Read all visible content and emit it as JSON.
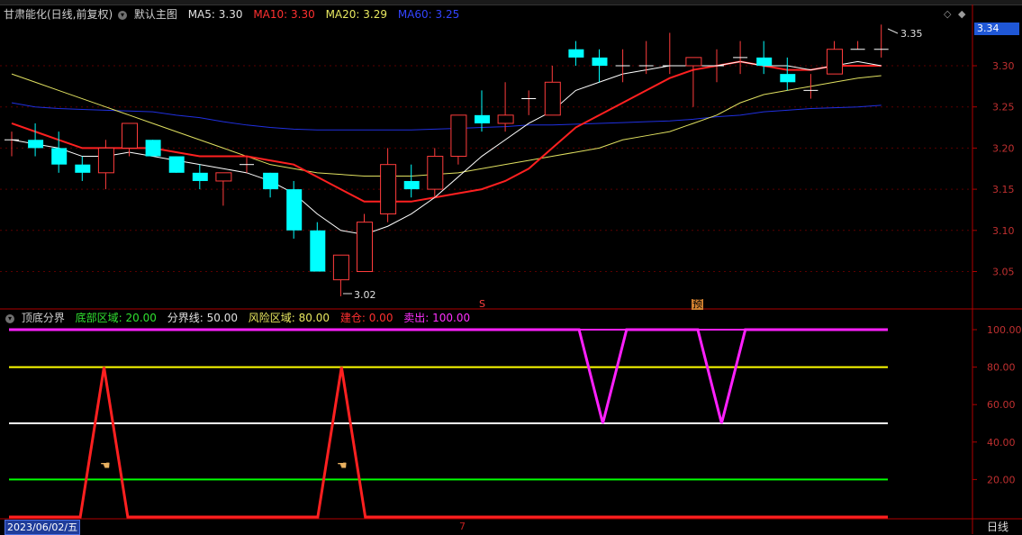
{
  "header": {
    "title": "甘肃能化(日线,前复权)",
    "main_indicator": "默认主图",
    "ma5_label": "MA5:",
    "ma5_value": "3.30",
    "ma10_label": "MA10:",
    "ma10_value": "3.30",
    "ma20_label": "MA20:",
    "ma20_value": "3.29",
    "ma60_label": "MA60:",
    "ma60_value": "3.25"
  },
  "indicator_header": {
    "name": "顶底分界",
    "bottom_label": "底部区域:",
    "bottom_value": "20.00",
    "divide_label": "分界线:",
    "divide_value": "50.00",
    "risk_label": "风险区域:",
    "risk_value": "80.00",
    "build_label": "建仓:",
    "build_value": "0.00",
    "sell_label": "卖出:",
    "sell_value": "100.00"
  },
  "price_tag": "3.34",
  "max_label": "3.35",
  "min_label": "3.02",
  "date_cursor": "2023/06/02/五",
  "period": "日线",
  "month_marker": "7",
  "marker_s": "S",
  "marker_yu": "预",
  "colors": {
    "up": "#ff3c3c",
    "down": "#00ffff",
    "ma5": "#ffffff",
    "ma10": "#ff2020",
    "ma20": "#e0e060",
    "ma60": "#2030e0",
    "axis": "#b00000",
    "indicator": "#ff2020",
    "sell": "#ff20ff",
    "bottom": "#00ff00",
    "divide": "#ffffff",
    "risk": "#ffff00"
  },
  "chart_data": [
    {
      "type": "candlestick",
      "title": "甘肃能化(日线,前复权)",
      "y_ticks": [
        "3.30",
        "3.25",
        "3.20",
        "3.15",
        "3.10",
        "3.05"
      ],
      "ylim": [
        3.02,
        3.38
      ],
      "candles": [
        {
          "o": 3.21,
          "h": 3.22,
          "l": 3.19,
          "c": 3.21
        },
        {
          "o": 3.21,
          "h": 3.23,
          "l": 3.19,
          "c": 3.2
        },
        {
          "o": 3.2,
          "h": 3.22,
          "l": 3.17,
          "c": 3.18
        },
        {
          "o": 3.18,
          "h": 3.19,
          "l": 3.16,
          "c": 3.17
        },
        {
          "o": 3.17,
          "h": 3.21,
          "l": 3.15,
          "c": 3.2
        },
        {
          "o": 3.2,
          "h": 3.23,
          "l": 3.19,
          "c": 3.23
        },
        {
          "o": 3.21,
          "h": 3.21,
          "l": 3.19,
          "c": 3.19
        },
        {
          "o": 3.19,
          "h": 3.19,
          "l": 3.17,
          "c": 3.17
        },
        {
          "o": 3.17,
          "h": 3.18,
          "l": 3.15,
          "c": 3.16
        },
        {
          "o": 3.16,
          "h": 3.17,
          "l": 3.13,
          "c": 3.17
        },
        {
          "o": 3.18,
          "h": 3.19,
          "l": 3.17,
          "c": 3.18
        },
        {
          "o": 3.17,
          "h": 3.17,
          "l": 3.14,
          "c": 3.15
        },
        {
          "o": 3.15,
          "h": 3.16,
          "l": 3.09,
          "c": 3.1
        },
        {
          "o": 3.1,
          "h": 3.11,
          "l": 3.05,
          "c": 3.05
        },
        {
          "o": 3.04,
          "h": 3.07,
          "l": 3.02,
          "c": 3.07
        },
        {
          "o": 3.05,
          "h": 3.12,
          "l": 3.05,
          "c": 3.11
        },
        {
          "o": 3.12,
          "h": 3.2,
          "l": 3.11,
          "c": 3.18
        },
        {
          "o": 3.16,
          "h": 3.18,
          "l": 3.14,
          "c": 3.15
        },
        {
          "o": 3.15,
          "h": 3.2,
          "l": 3.14,
          "c": 3.19
        },
        {
          "o": 3.19,
          "h": 3.24,
          "l": 3.18,
          "c": 3.24
        },
        {
          "o": 3.24,
          "h": 3.27,
          "l": 3.22,
          "c": 3.23
        },
        {
          "o": 3.23,
          "h": 3.28,
          "l": 3.22,
          "c": 3.24
        },
        {
          "o": 3.26,
          "h": 3.27,
          "l": 3.24,
          "c": 3.26
        },
        {
          "o": 3.24,
          "h": 3.3,
          "l": 3.24,
          "c": 3.28
        },
        {
          "o": 3.32,
          "h": 3.33,
          "l": 3.3,
          "c": 3.31
        },
        {
          "o": 3.31,
          "h": 3.32,
          "l": 3.28,
          "c": 3.3
        },
        {
          "o": 3.3,
          "h": 3.32,
          "l": 3.28,
          "c": 3.3
        },
        {
          "o": 3.3,
          "h": 3.33,
          "l": 3.29,
          "c": 3.3
        },
        {
          "o": 3.3,
          "h": 3.34,
          "l": 3.29,
          "c": 3.3
        },
        {
          "o": 3.3,
          "h": 3.31,
          "l": 3.25,
          "c": 3.31
        },
        {
          "o": 3.3,
          "h": 3.32,
          "l": 3.28,
          "c": 3.3
        },
        {
          "o": 3.31,
          "h": 3.33,
          "l": 3.29,
          "c": 3.31
        },
        {
          "o": 3.31,
          "h": 3.33,
          "l": 3.29,
          "c": 3.3
        },
        {
          "o": 3.29,
          "h": 3.31,
          "l": 3.27,
          "c": 3.28
        },
        {
          "o": 3.27,
          "h": 3.29,
          "l": 3.26,
          "c": 3.27
        },
        {
          "o": 3.29,
          "h": 3.33,
          "l": 3.29,
          "c": 3.32
        },
        {
          "o": 3.32,
          "h": 3.33,
          "l": 3.32,
          "c": 3.32
        },
        {
          "o": 3.32,
          "h": 3.35,
          "l": 3.31,
          "c": 3.32
        }
      ],
      "ma5": [
        3.21,
        3.205,
        3.2,
        3.19,
        3.19,
        3.195,
        3.19,
        3.185,
        3.18,
        3.175,
        3.17,
        3.16,
        3.145,
        3.12,
        3.1,
        3.095,
        3.105,
        3.12,
        3.14,
        3.165,
        3.19,
        3.21,
        3.23,
        3.245,
        3.27,
        3.28,
        3.29,
        3.295,
        3.3,
        3.3,
        3.3,
        3.305,
        3.3,
        3.3,
        3.295,
        3.3,
        3.305,
        3.3
      ],
      "ma10": [
        3.23,
        3.22,
        3.21,
        3.2,
        3.2,
        3.2,
        3.2,
        3.195,
        3.19,
        3.19,
        3.19,
        3.185,
        3.18,
        3.165,
        3.15,
        3.135,
        3.135,
        3.135,
        3.14,
        3.145,
        3.15,
        3.16,
        3.175,
        3.2,
        3.225,
        3.24,
        3.255,
        3.27,
        3.285,
        3.295,
        3.3,
        3.305,
        3.3,
        3.295,
        3.295,
        3.3,
        3.3,
        3.3
      ],
      "ma20": [
        3.29,
        3.28,
        3.27,
        3.26,
        3.25,
        3.24,
        3.23,
        3.22,
        3.21,
        3.2,
        3.19,
        3.18,
        3.175,
        3.17,
        3.168,
        3.166,
        3.166,
        3.166,
        3.168,
        3.17,
        3.175,
        3.18,
        3.185,
        3.19,
        3.195,
        3.2,
        3.21,
        3.215,
        3.22,
        3.23,
        3.24,
        3.255,
        3.265,
        3.27,
        3.275,
        3.28,
        3.285,
        3.288
      ],
      "ma60": [
        3.255,
        3.25,
        3.248,
        3.247,
        3.246,
        3.245,
        3.244,
        3.24,
        3.237,
        3.232,
        3.228,
        3.225,
        3.223,
        3.222,
        3.222,
        3.222,
        3.222,
        3.222,
        3.223,
        3.224,
        3.225,
        3.226,
        3.228,
        3.228,
        3.229,
        3.23,
        3.231,
        3.232,
        3.233,
        3.235,
        3.238,
        3.24,
        3.244,
        3.246,
        3.248,
        3.249,
        3.25,
        3.252
      ]
    },
    {
      "type": "line",
      "title": "顶底分界",
      "y_ticks": [
        "100.00",
        "80.00",
        "60.00",
        "40.00",
        "20.00"
      ],
      "ylim": [
        0,
        100
      ],
      "levels": {
        "bottom": 20,
        "divide": 50,
        "risk": 80,
        "sell": 100
      },
      "series": [
        {
          "name": "建仓",
          "values": [
            0,
            0,
            0,
            0,
            80,
            0,
            0,
            0,
            0,
            0,
            0,
            0,
            0,
            0,
            80,
            0,
            0,
            0,
            0,
            0,
            0,
            0,
            0,
            0,
            0,
            0,
            0,
            0,
            0,
            0,
            0,
            0,
            0,
            0,
            0,
            0,
            0,
            0
          ]
        },
        {
          "name": "卖出",
          "values": [
            100,
            100,
            100,
            100,
            100,
            100,
            100,
            100,
            100,
            100,
            100,
            100,
            100,
            100,
            100,
            100,
            100,
            100,
            100,
            100,
            100,
            100,
            100,
            100,
            100,
            50,
            100,
            100,
            100,
            100,
            50,
            100,
            100,
            100,
            100,
            100,
            100,
            100
          ]
        }
      ]
    }
  ]
}
